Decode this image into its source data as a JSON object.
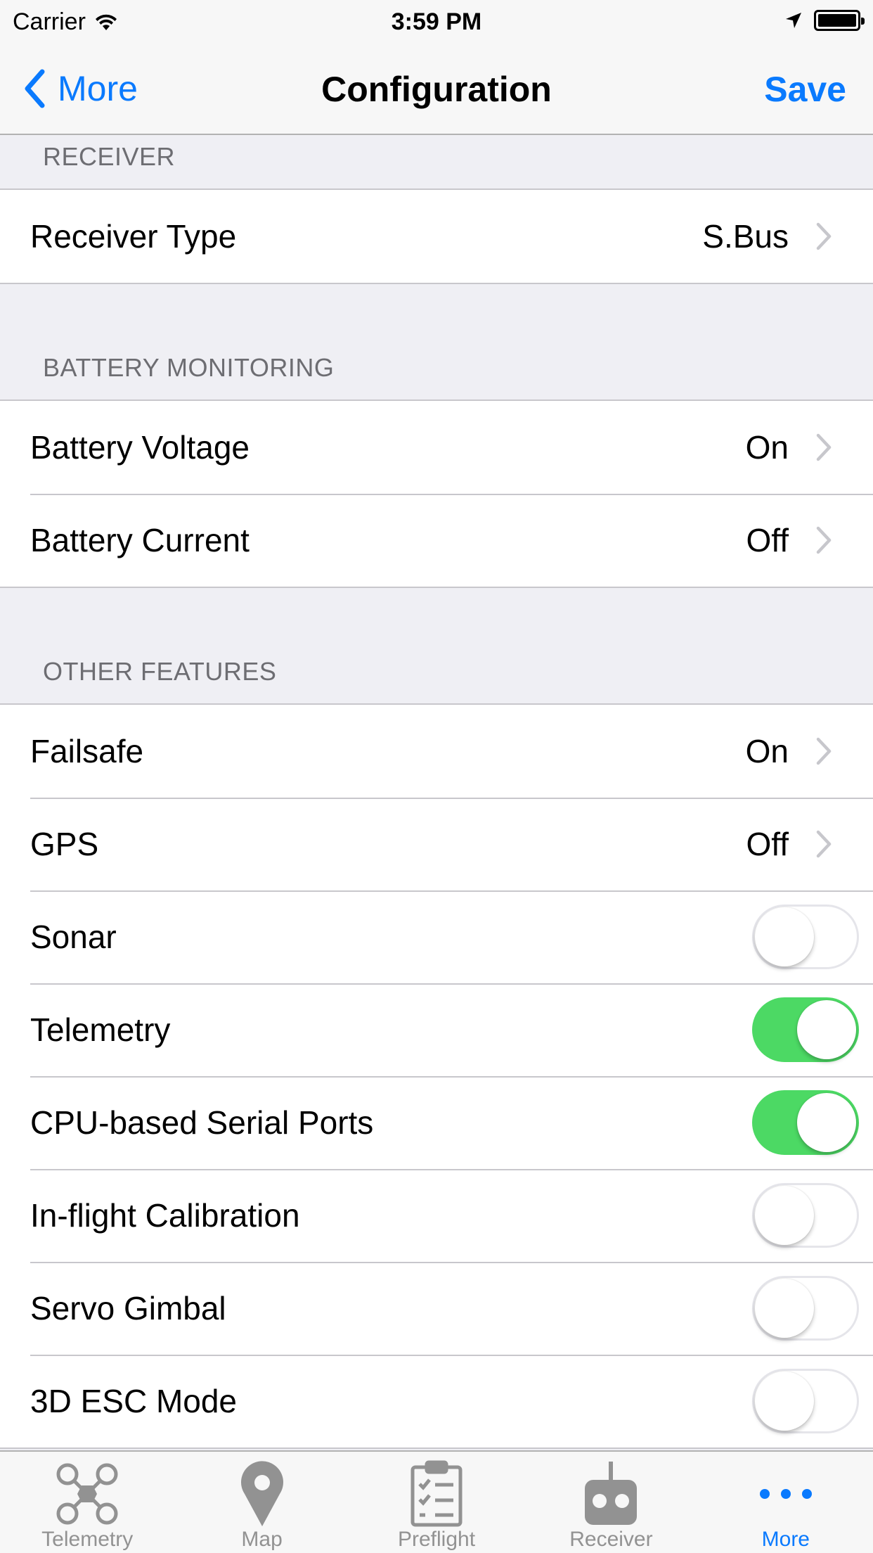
{
  "status_bar": {
    "carrier": "Carrier",
    "time": "3:59 PM"
  },
  "nav": {
    "back_label": "More",
    "title": "Configuration",
    "save_label": "Save"
  },
  "sections": {
    "receiver": {
      "header": "RECEIVER",
      "receiver_type": {
        "label": "Receiver Type",
        "value": "S.Bus"
      }
    },
    "battery": {
      "header": "BATTERY MONITORING",
      "voltage": {
        "label": "Battery Voltage",
        "value": "On"
      },
      "current": {
        "label": "Battery Current",
        "value": "Off"
      }
    },
    "other": {
      "header": "OTHER FEATURES",
      "failsafe": {
        "label": "Failsafe",
        "value": "On"
      },
      "gps": {
        "label": "GPS",
        "value": "Off"
      },
      "sonar": {
        "label": "Sonar",
        "on": false
      },
      "telemetry": {
        "label": "Telemetry",
        "on": true
      },
      "cpu_serial": {
        "label": "CPU-based Serial Ports",
        "on": true
      },
      "inflight_cal": {
        "label": "In-flight Calibration",
        "on": false
      },
      "servo_gimbal": {
        "label": "Servo Gimbal",
        "on": false
      },
      "esc_3d": {
        "label": "3D ESC Mode",
        "on": false
      }
    }
  },
  "tab_bar": {
    "tabs": [
      {
        "label": "Telemetry",
        "icon": "quadcopter-icon"
      },
      {
        "label": "Map",
        "icon": "map-pin-icon"
      },
      {
        "label": "Preflight",
        "icon": "clipboard-checklist-icon"
      },
      {
        "label": "Receiver",
        "icon": "transmitter-icon"
      },
      {
        "label": "More",
        "icon": "more-dots-icon",
        "active": true
      }
    ]
  },
  "colors": {
    "accent": "#0a7afe",
    "switch_on": "#4cd964",
    "grouped_background": "#efeff4",
    "section_text": "#6d6d72",
    "tab_inactive": "#929292"
  }
}
